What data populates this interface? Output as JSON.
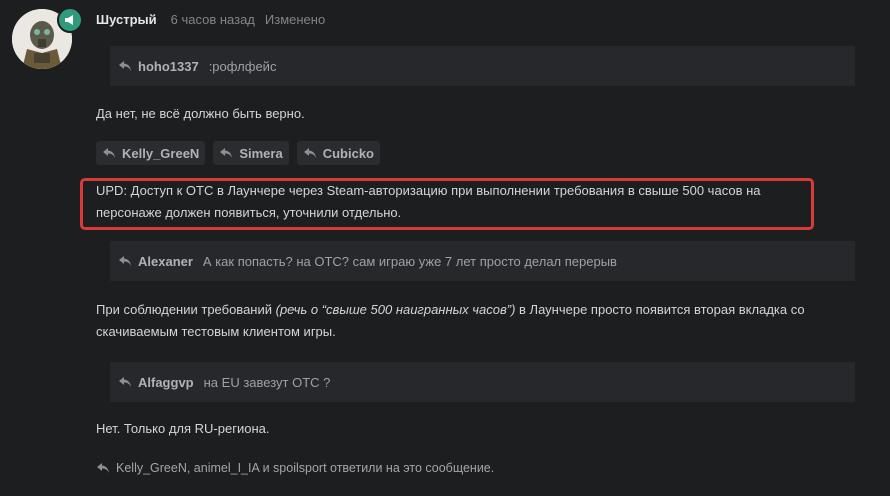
{
  "post": {
    "author": "Шустрый",
    "time": "6 часов назад",
    "edited": "Изменено"
  },
  "quotes": [
    {
      "author": "hoho1337",
      "text": ":рофлфейс"
    },
    {
      "author": "Alexaner",
      "text": "А как попасть? на ОТС? сам играю уже 7 лет просто делал перерыв"
    },
    {
      "author": "Alfaggvp",
      "text": "на EU завезут ОТС ?"
    }
  ],
  "paragraphs": {
    "p1": "Да нет, не всё должно быть верно.",
    "upd_line1": "UPD: Доступ к ОТС в Лаунчере через Steam-авторизацию при выполнении требования в свыше 500 часов на",
    "upd_line2": "персонаже должен появиться, уточнили отдельно.",
    "p3_a": "При соблюдении требований ",
    "p3_italic": "(речь о “свыше 500 наигранных часов”)",
    "p3_b": " в Лаунчере просто появится вторая вкладка со",
    "p3_line2": "скачиваемым тестовым клиентом игры.",
    "p4": "Нет. Только для RU-региона."
  },
  "mentions": [
    "Kelly_GreeN",
    "Simera",
    "Cubicko"
  ],
  "replied": "Kelly_GreeN, animel_I_IA и spoilsport ответили на это сообщение.",
  "colors": {
    "background": "#1c1e20",
    "quote_bg": "#26282b",
    "highlight": "#d93a3a",
    "badge": "#2f9b7c"
  }
}
